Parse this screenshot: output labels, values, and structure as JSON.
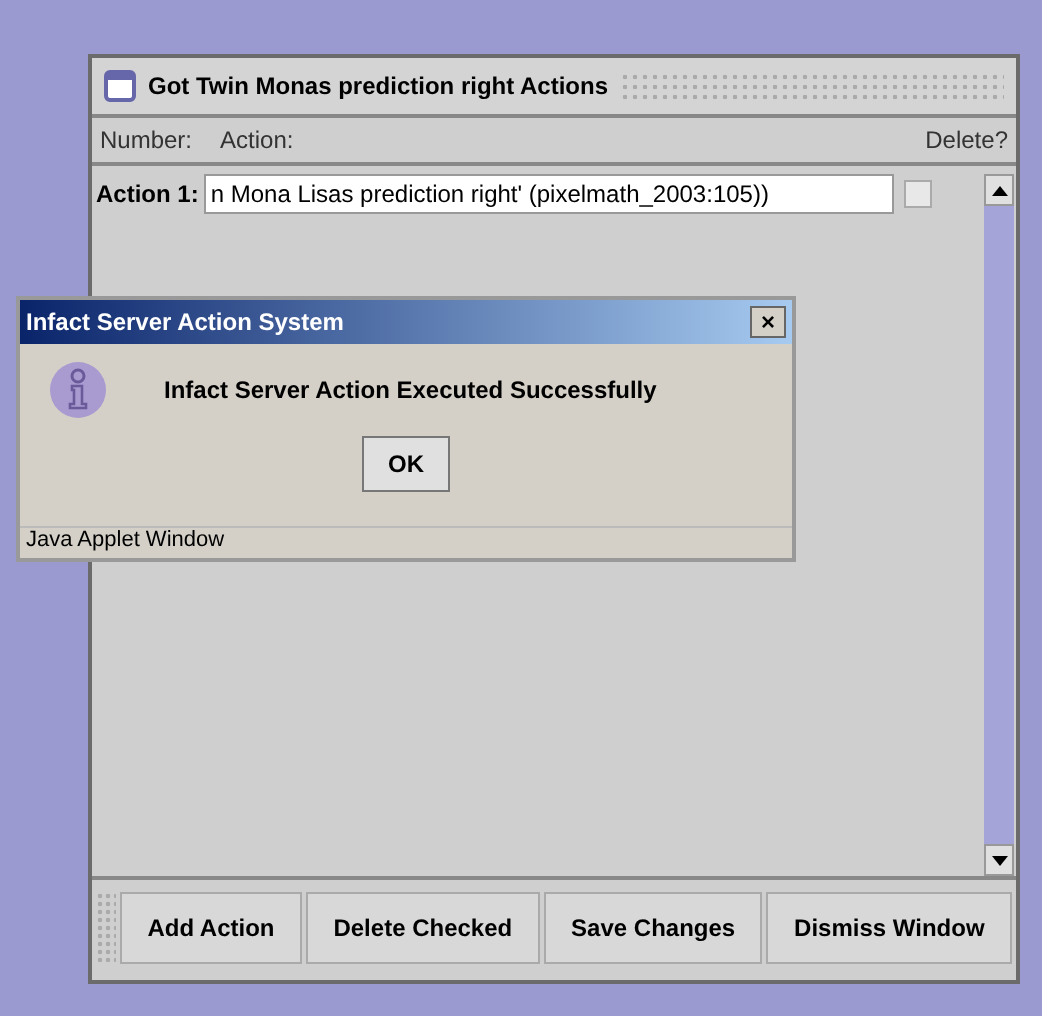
{
  "window": {
    "title": "Got Twin Monas prediction right Actions"
  },
  "columns": [
    "Number:",
    "Action:",
    "Delete?"
  ],
  "actions": [
    {
      "label": "Action 1:",
      "value": "n Mona Lisas prediction right' (pixelmath_2003:105))",
      "checked": false
    }
  ],
  "buttons": [
    "Add Action",
    "Delete Checked",
    "Save Changes",
    "Dismiss Window"
  ],
  "dialog": {
    "title": "Infact Server Action System",
    "close": "×",
    "message": "Infact Server Action Executed Successfully",
    "button": "OK",
    "footer": "Java Applet Window"
  }
}
